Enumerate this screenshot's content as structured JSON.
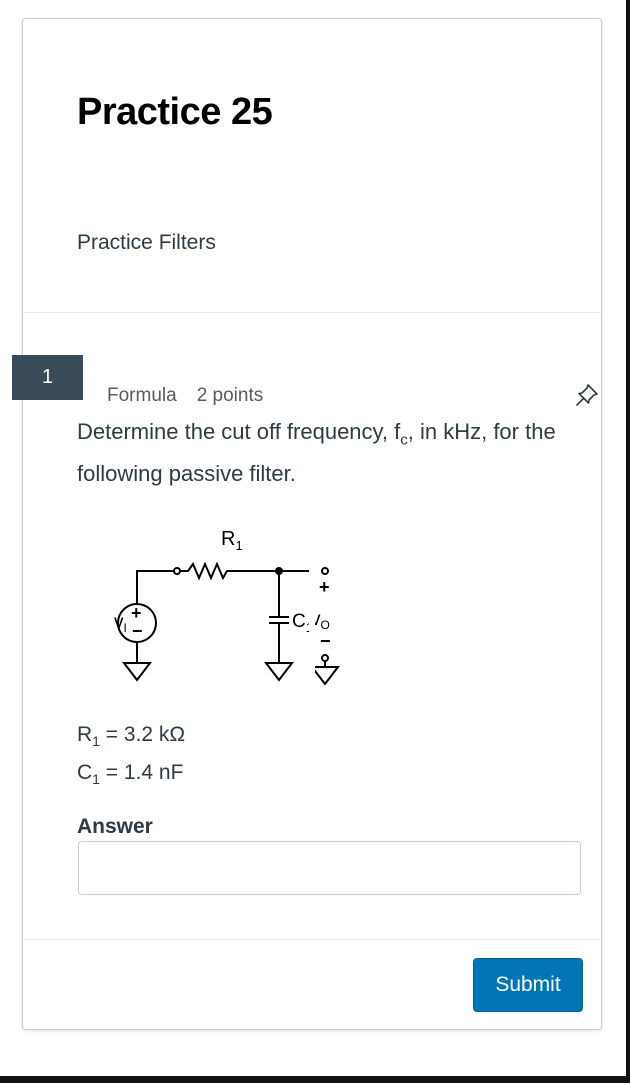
{
  "page": {
    "title": "Practice 25",
    "subtitle": "Practice Filters"
  },
  "question": {
    "number": "1",
    "type": "Formula",
    "points": "2 points",
    "pin_icon": "pin-icon",
    "prompt_before": "Determine the cut off frequency, f",
    "prompt_sub": "c",
    "prompt_after": ", in kHz, for the following passive filter.",
    "circuit": {
      "r_label": "R",
      "r_sub": "1",
      "c_label": "C",
      "c_sub": "1",
      "vin_label": "v",
      "vin_sub": "I",
      "vout_label": "v",
      "vout_sub": "O",
      "plus": "+",
      "minus": "−"
    },
    "given": [
      {
        "symbol": "R",
        "sub": "1",
        "text": " = 3.2 kΩ"
      },
      {
        "symbol": "C",
        "sub": "1",
        "text": " = 1.4 nF"
      }
    ]
  },
  "answer": {
    "label": "Answer",
    "value": "",
    "placeholder": ""
  },
  "submit": {
    "label": "Submit",
    "color": "#0374b5"
  }
}
